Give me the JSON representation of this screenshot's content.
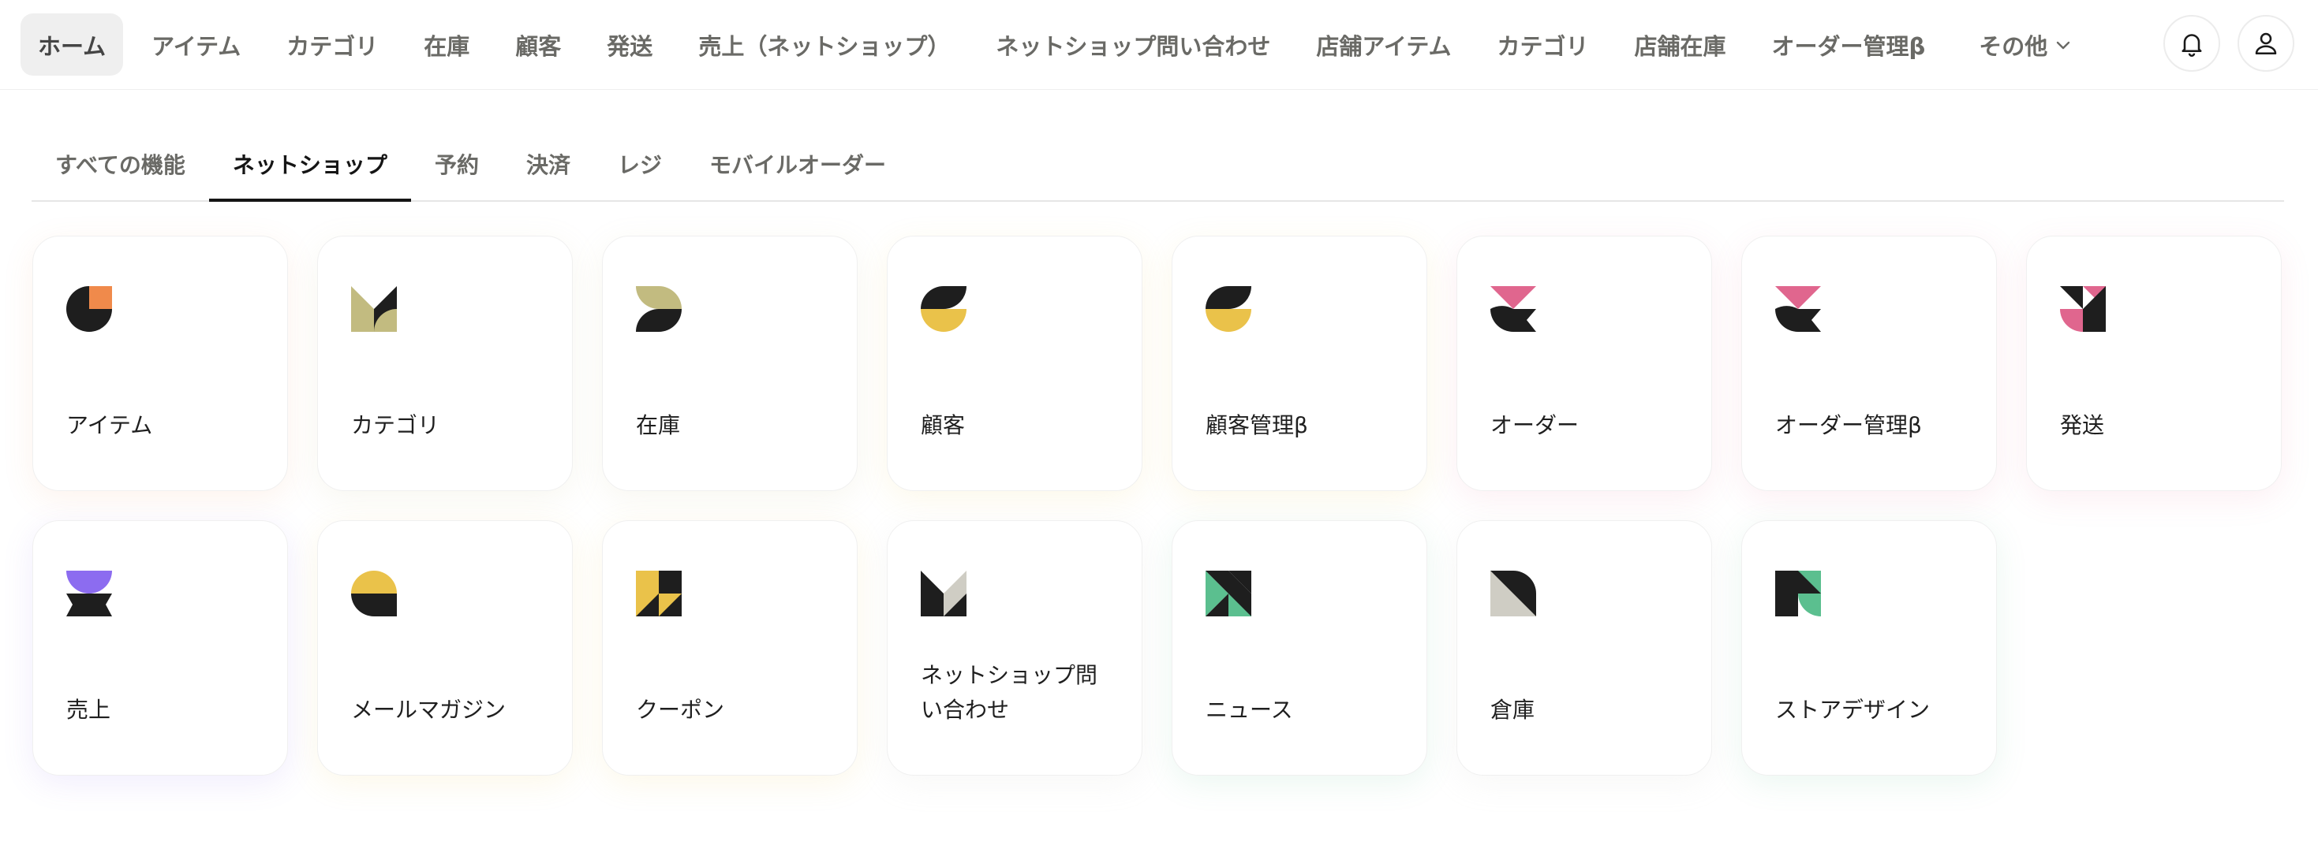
{
  "topnav": {
    "items": [
      {
        "label": "ホーム",
        "active": true
      },
      {
        "label": "アイテム"
      },
      {
        "label": "カテゴリ"
      },
      {
        "label": "在庫"
      },
      {
        "label": "顧客"
      },
      {
        "label": "発送"
      },
      {
        "label": "売上（ネットショップ）"
      },
      {
        "label": "ネットショップ問い合わせ"
      },
      {
        "label": "店舗アイテム"
      },
      {
        "label": "カテゴリ"
      },
      {
        "label": "店舗在庫"
      },
      {
        "label": "オーダー管理β"
      }
    ],
    "more_label": "その他",
    "notification_icon": "bell-icon",
    "account_icon": "user-icon"
  },
  "subtabs": [
    {
      "label": "すべての機能"
    },
    {
      "label": "ネットショップ",
      "active": true
    },
    {
      "label": "予約"
    },
    {
      "label": "決済"
    },
    {
      "label": "レジ"
    },
    {
      "label": "モバイルオーダー"
    }
  ],
  "cards": [
    {
      "label": "アイテム",
      "icon": "item-icon"
    },
    {
      "label": "カテゴリ",
      "icon": "category-icon"
    },
    {
      "label": "在庫",
      "icon": "inventory-icon"
    },
    {
      "label": "顧客",
      "icon": "customer-icon"
    },
    {
      "label": "顧客管理β",
      "icon": "customer-management-icon"
    },
    {
      "label": "オーダー",
      "icon": "order-icon"
    },
    {
      "label": "オーダー管理β",
      "icon": "order-management-icon"
    },
    {
      "label": "発送",
      "icon": "shipping-icon"
    },
    {
      "label": "売上",
      "icon": "sales-icon"
    },
    {
      "label": "メールマガジン",
      "icon": "mail-magazine-icon"
    },
    {
      "label": "クーポン",
      "icon": "coupon-icon"
    },
    {
      "label": "ネットショップ問い合わせ",
      "icon": "inquiry-icon"
    },
    {
      "label": "ニュース",
      "icon": "news-icon"
    },
    {
      "label": "倉庫",
      "icon": "warehouse-icon"
    },
    {
      "label": "ストアデザイン",
      "icon": "store-design-icon"
    }
  ],
  "colors": {
    "dark": "#1e1e1e",
    "orange": "#f08a4b",
    "olive": "#c2bb80",
    "yellow": "#eac24a",
    "pink": "#e0668e",
    "purple": "#8c6cf0",
    "green": "#5bbf8f",
    "gray": "#cfcdc4"
  }
}
